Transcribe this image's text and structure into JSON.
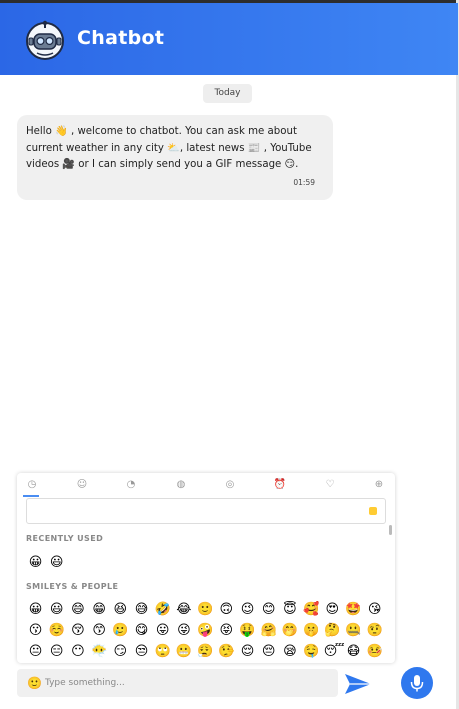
{
  "header": {
    "title": "Chatbot",
    "accent_color": "#3a7df0"
  },
  "chat": {
    "day_label": "Today",
    "messages": [
      {
        "text": "Hello 👋 , welcome to chatbot. You can ask me about current weather in any city ⛅, latest news 📰 , YouTube videos 🎥 or I can simply send you a GIF message 😏.",
        "time": "01:59"
      }
    ]
  },
  "emoji_picker": {
    "categories": [
      "recent-icon",
      "smileys-icon",
      "animals-icon",
      "food-icon",
      "activity-icon",
      "travel-icon",
      "objects-icon",
      "symbols-icon"
    ],
    "search_placeholder": "",
    "recently_used_label": "RECENTLY USED",
    "recently_used": [
      "😀",
      "😃"
    ],
    "smileys_label": "SMILEYS & PEOPLE",
    "smileys": [
      "😀",
      "😃",
      "😄",
      "😁",
      "😆",
      "😅",
      "🤣",
      "😂",
      "🙂",
      "🙃",
      "😉",
      "😊",
      "😇",
      "🥰",
      "😍",
      "🤩",
      "😘",
      "😗",
      "☺️",
      "😚",
      "😙",
      "🥲",
      "😋",
      "😛",
      "😜",
      "🤪",
      "😝",
      "🤑",
      "🤗",
      "🤭",
      "🤫",
      "🤔",
      "🤐",
      "🤨",
      "😐",
      "😑",
      "😶",
      "😶‍🌫️",
      "😏",
      "😒",
      "🙄",
      "😬",
      "😮‍💨",
      "🤥",
      "😌",
      "😔",
      "😪",
      "🤤",
      "😴",
      "😷",
      "🤒"
    ]
  },
  "composer": {
    "placeholder": "Type something...",
    "value": ""
  }
}
